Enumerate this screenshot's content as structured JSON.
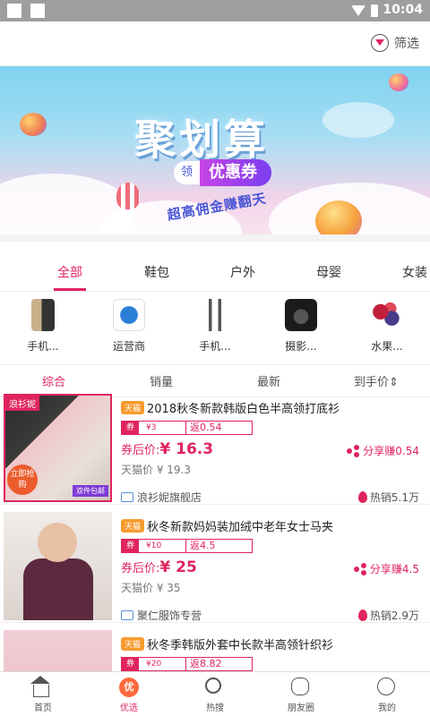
{
  "status_bar": {
    "time": "10:04"
  },
  "header": {
    "filter_label": "筛选"
  },
  "banner": {
    "title": "聚划算",
    "coupon_prefix": "领",
    "coupon_label": "优惠券",
    "subtitle": "超高佣金赚翻天"
  },
  "tabs": [
    {
      "label": "全部",
      "active": true
    },
    {
      "label": "鞋包"
    },
    {
      "label": "户外"
    },
    {
      "label": "母婴"
    },
    {
      "label": "女装"
    }
  ],
  "categories": [
    {
      "label": "手机...",
      "icon": "phone-icon"
    },
    {
      "label": "运营商",
      "icon": "china-mobile-icon"
    },
    {
      "label": "手机...",
      "icon": "earphone-icon"
    },
    {
      "label": "摄影...",
      "icon": "camera-icon"
    },
    {
      "label": "水果...",
      "icon": "fruit-icon"
    }
  ],
  "sorts": [
    {
      "label": "综合",
      "active": true
    },
    {
      "label": "销量"
    },
    {
      "label": "最新"
    },
    {
      "label": "到手价⇕"
    }
  ],
  "products": [
    {
      "badge": "天猫",
      "title": "2018秋冬新款韩版白色半高领打底衫",
      "coupon_tag": "券",
      "coupon_value": "¥3",
      "rebate": "返0.54",
      "price_label": "券后价:",
      "price": "¥ 16.3",
      "share": "分享赚0.54",
      "tmall_price": "天猫价 ¥ 19.3",
      "shop": "浪衫妮旗舰店",
      "sales": "热销5.1万",
      "thumb_badge": "浪衫妮",
      "thumb_round": "立即抢购",
      "thumb_tag": "双件包邮"
    },
    {
      "badge": "天猫",
      "title": "秋冬新款妈妈装加绒中老年女士马夹",
      "coupon_tag": "券",
      "coupon_value": "¥10",
      "rebate": "返4.5",
      "price_label": "券后价:",
      "price": "¥ 25",
      "share": "分享赚4.5",
      "tmall_price": "天猫价 ¥ 35",
      "shop": "聚仁服饰专营",
      "sales": "热销2.9万"
    },
    {
      "badge": "天猫",
      "title": "秋冬季韩版外套中长款半高领针织衫",
      "coupon_tag": "券",
      "coupon_value": "¥20",
      "rebate": "返8.82"
    }
  ],
  "bottom_nav": [
    {
      "label": "首页",
      "icon": "home-icon"
    },
    {
      "label": "优选",
      "icon": "youxuan-icon",
      "active": true,
      "glyph": "优"
    },
    {
      "label": "热搜",
      "icon": "hot-search-icon"
    },
    {
      "label": "朋友圈",
      "icon": "moments-icon"
    },
    {
      "label": "我的",
      "icon": "profile-icon"
    }
  ],
  "colors": {
    "accent": "#e0245e",
    "tmall_badge": "#f79b2e",
    "nav_active": "#ff6a3d"
  }
}
